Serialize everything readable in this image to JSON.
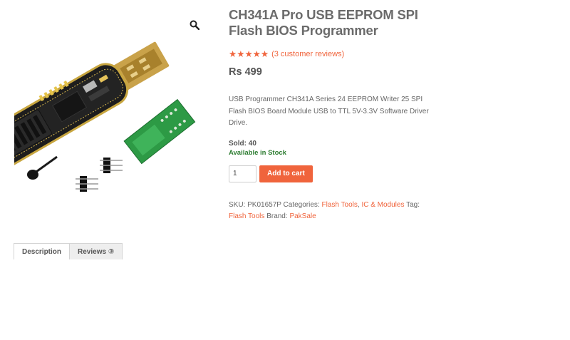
{
  "product": {
    "title": "CH341A Pro USB EEPROM SPI Flash BIOS Programmer",
    "rating": {
      "stars": 5,
      "reviews_text": "(3 customer reviews)"
    },
    "price": "Rs 499",
    "description": "USB Programmer CH341A Series 24 EEPROM Writer 25 SPI Flash BIOS Board Module USB to TTL 5V-3.3V Software Driver Drive.",
    "sold": "Sold: 40",
    "stock": "Available in Stock",
    "quantity": "1",
    "add_to_cart": "Add to cart"
  },
  "meta": {
    "sku_label": "SKU:",
    "sku": "PK01657P",
    "categories_label": "Categories:",
    "categories": [
      "Flash Tools",
      "IC & Modules"
    ],
    "separator": ",",
    "tag_label": "Tag:",
    "tag": "Flash Tools",
    "brand_label": "Brand:",
    "brand": "PakSale"
  },
  "tabs": [
    {
      "label": "Description"
    },
    {
      "label": "Reviews ③"
    }
  ],
  "colors": {
    "accent": "#f0643c",
    "stock": "#2e7d32",
    "title": "#6b6b6b"
  },
  "icons": {
    "zoom": "magnifier-icon",
    "star": "star-icon"
  }
}
